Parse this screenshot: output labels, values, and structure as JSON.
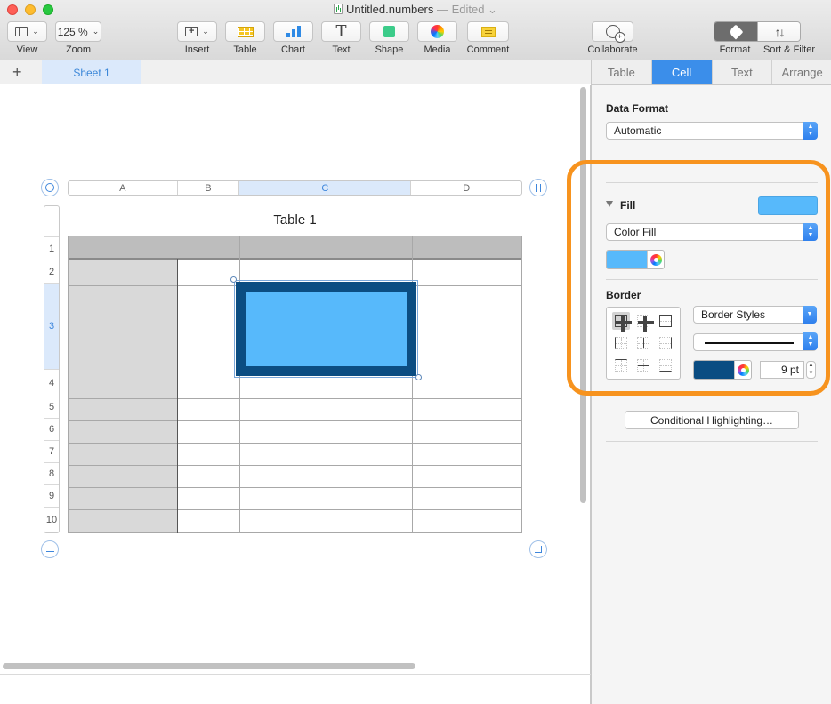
{
  "window": {
    "doc_title": "Untitled.numbers",
    "doc_status": "— Edited"
  },
  "toolbar": {
    "view_label": "View",
    "zoom_value": "125 %",
    "zoom_label": "Zoom",
    "insert_label": "Insert",
    "table_label": "Table",
    "chart_label": "Chart",
    "text_label": "Text",
    "shape_label": "Shape",
    "media_label": "Media",
    "comment_label": "Comment",
    "collaborate_label": "Collaborate",
    "format_label": "Format",
    "sort_filter_label": "Sort & Filter"
  },
  "sheets": {
    "add_label": "+",
    "tabs": [
      "Sheet 1"
    ]
  },
  "table": {
    "title": "Table 1",
    "columns": [
      "A",
      "B",
      "C",
      "D"
    ],
    "selected_column": "C",
    "rows": [
      "1",
      "2",
      "3",
      "4",
      "5",
      "6",
      "7",
      "8",
      "9",
      "10"
    ],
    "selected_row": "3"
  },
  "inspector": {
    "tabs": [
      "Table",
      "Cell",
      "Text",
      "Arrange"
    ],
    "active_tab": "Cell",
    "data_format_label": "Data Format",
    "data_format_value": "Automatic",
    "fill_label": "Fill",
    "fill_type": "Color Fill",
    "fill_color": "#57b9fb",
    "border_label": "Border",
    "border_styles_value": "Border Styles",
    "border_color": "#0b4d82",
    "border_width": "9 pt",
    "conditional_button": "Conditional Highlighting…"
  },
  "colors": {
    "accent": "#3b8eea",
    "highlight_ring": "#f7931e",
    "cell_fill": "#57b9fb",
    "cell_border": "#0b4d82"
  }
}
